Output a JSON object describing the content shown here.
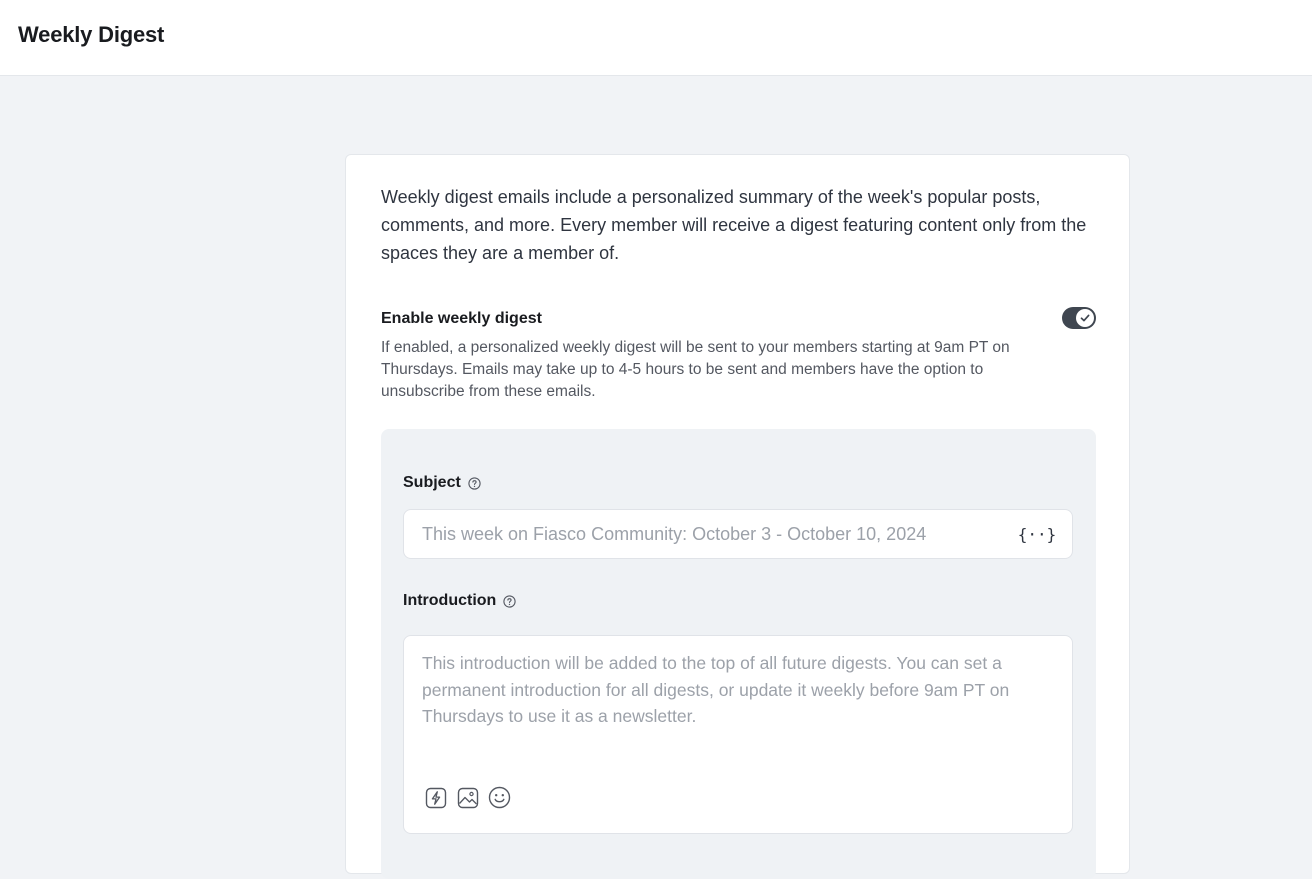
{
  "header": {
    "title": "Weekly Digest"
  },
  "card": {
    "description": "Weekly digest emails include a personalized summary of the week's popular posts, comments, and more. Every member will receive a digest featuring content only from the spaces they are a member of.",
    "enable": {
      "title": "Enable weekly digest",
      "description": "If enabled, a personalized weekly digest will be sent to your members starting at 9am PT on Thursdays. Emails may take up to 4-5 hours to be sent and members have the option to unsubscribe from these emails.",
      "enabled": true
    },
    "subject": {
      "label": "Subject",
      "placeholder": "This week on Fiasco Community: October 3 - October 10, 2024",
      "value": "",
      "help_icon": "question-circle-icon",
      "variables_icon": "braces-icon",
      "variables_glyph": "{··}"
    },
    "introduction": {
      "label": "Introduction",
      "placeholder": "This introduction will be added to the top of all future digests. You can set a permanent introduction for all digests, or update it weekly before 9am PT on Thursdays to use it as a newsletter.",
      "value": "",
      "help_icon": "question-circle-icon",
      "tools": [
        "lightning-icon",
        "image-icon",
        "emoji-icon"
      ]
    }
  },
  "colors": {
    "toggle_on": "#3f4650",
    "panel_bg": "#eff2f5",
    "page_bg": "#f1f3f6",
    "placeholder": "#9ca1a9"
  }
}
